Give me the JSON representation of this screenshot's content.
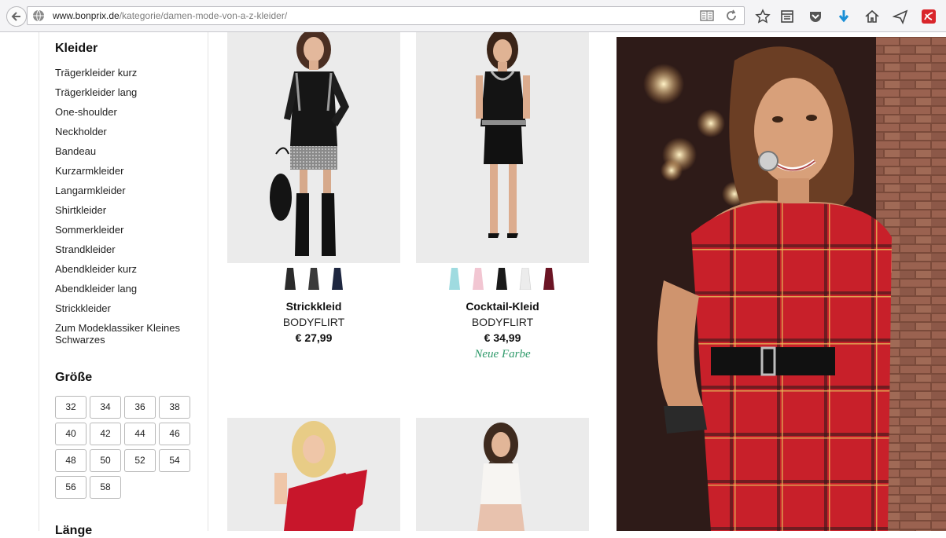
{
  "browser": {
    "url_domain": "www.bonprix.de",
    "url_path": "/kategorie/damen-mode-von-a-z-kleider/"
  },
  "sidebar": {
    "heading": "Kleider",
    "categories": [
      "Trägerkleider kurz",
      "Trägerkleider lang",
      "One-shoulder",
      "Neckholder",
      "Bandeau",
      "Kurzarmkleider",
      "Langarmkleider",
      "Shirtkleider",
      "Sommerkleider",
      "Strandkleider",
      "Abendkleider kurz",
      "Abendkleider lang",
      "Strickkleider",
      "Zum Modeklassiker Kleines Schwarzes"
    ],
    "size_heading": "Größe",
    "sizes": [
      "32",
      "34",
      "36",
      "38",
      "40",
      "42",
      "44",
      "46",
      "48",
      "50",
      "52",
      "54",
      "56",
      "58"
    ],
    "next_heading": "Länge"
  },
  "products": [
    {
      "name": "Strickkleid",
      "brand": "BODYFLIRT",
      "price": "€ 27,99",
      "swatches": [
        "#2b2b2b",
        "#3a3a3a",
        "#1e2740"
      ]
    },
    {
      "name": "Cocktail-Kleid",
      "brand": "BODYFLIRT",
      "price": "€ 34,99",
      "badge": "Neue Farbe",
      "swatches": [
        "#9fdbe0",
        "#f2c6d2",
        "#1a1a1a",
        "#ececec",
        "#6b1424"
      ]
    }
  ],
  "colors": {
    "accent_green": "#2e9a6a",
    "download_blue": "#1a8fd6",
    "hero_dress_red": "#c8202a"
  }
}
